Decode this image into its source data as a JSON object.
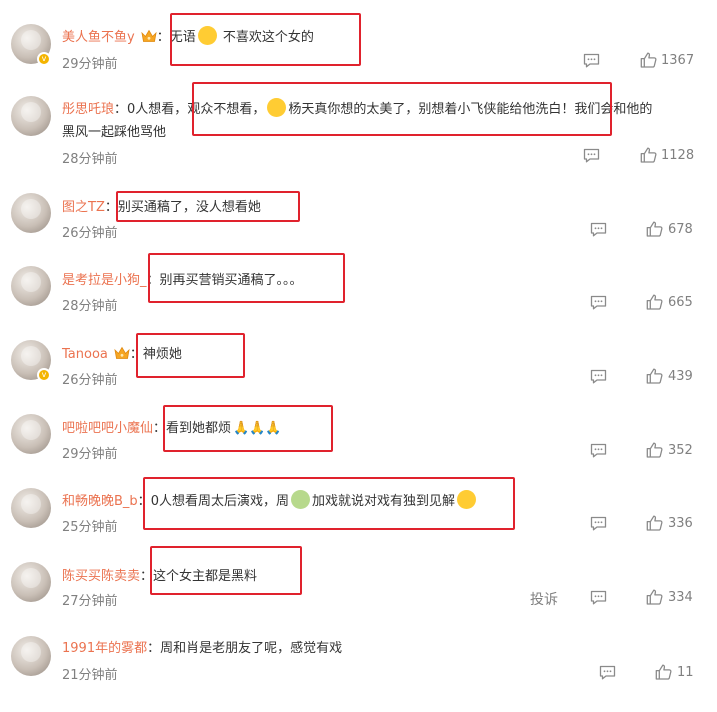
{
  "comments": [
    {
      "user": "美人鱼不鱼y",
      "pre": "：",
      "text1": "无语",
      "text2": " 不喜欢这个女的",
      "text3": "",
      "line2": "",
      "time": "29分钟前",
      "likes": "1367"
    },
    {
      "user": "彤思吒琅",
      "pre": "：",
      "text1": "0人想看，",
      "text2": "观众不想看，",
      "text3": "杨天真你想的太美了，别想着小飞侠能给他洗白！我们会和他的",
      "line2": "黑风一起踩他骂他",
      "time": "28分钟前",
      "likes": "1128"
    },
    {
      "user": "图之TZ",
      "pre": "：",
      "text1": "别买通稿了，没人想看她",
      "text2": "",
      "text3": "",
      "line2": "",
      "time": "26分钟前",
      "likes": "678"
    },
    {
      "user": "是考拉是小狗_",
      "pre": "：",
      "text1": "别再买营销买通稿了。。。",
      "text2": "",
      "text3": "",
      "line2": "",
      "time": "28分钟前",
      "likes": "665"
    },
    {
      "user": "Tanooa",
      "pre": "：",
      "text1": "神烦她",
      "text2": "",
      "text3": "",
      "line2": "",
      "time": "26分钟前",
      "likes": "439"
    },
    {
      "user": "吧啦吧吧小魔仙",
      "pre": "：",
      "text1": "看到她都烦",
      "text2": "",
      "text3": "",
      "line2": "",
      "time": "29分钟前",
      "likes": "352"
    },
    {
      "user": "和畅晚晚B_b",
      "pre": "：",
      "text1": "0人想看周太后演戏，周",
      "text2": "加戏就说对戏有独到见解",
      "text3": "",
      "line2": "",
      "time": "25分钟前",
      "likes": "336"
    },
    {
      "user": "陈买买陈卖卖",
      "pre": "：",
      "text1": "这个女主都是黑料",
      "text2": "",
      "text3": "",
      "line2": "",
      "time": "27分钟前",
      "likes": "334",
      "report": "投诉"
    },
    {
      "user": "1991年的雾都",
      "pre": "：",
      "text1": "周和肖是老朋友了呢，感觉有戏",
      "text2": "",
      "text3": "",
      "line2": "",
      "time": "21分钟前",
      "likes": "11"
    }
  ],
  "icons": {
    "reply": "comment-reply-icon",
    "like": "thumbs-up-icon",
    "emoji": "emoji-icon",
    "crown": "vip-crown-icon",
    "verified": "verified-badge-icon"
  },
  "colors": {
    "username": "#eb7350",
    "text": "#333333",
    "meta": "#808080",
    "highlight_box": "#e0222d"
  }
}
